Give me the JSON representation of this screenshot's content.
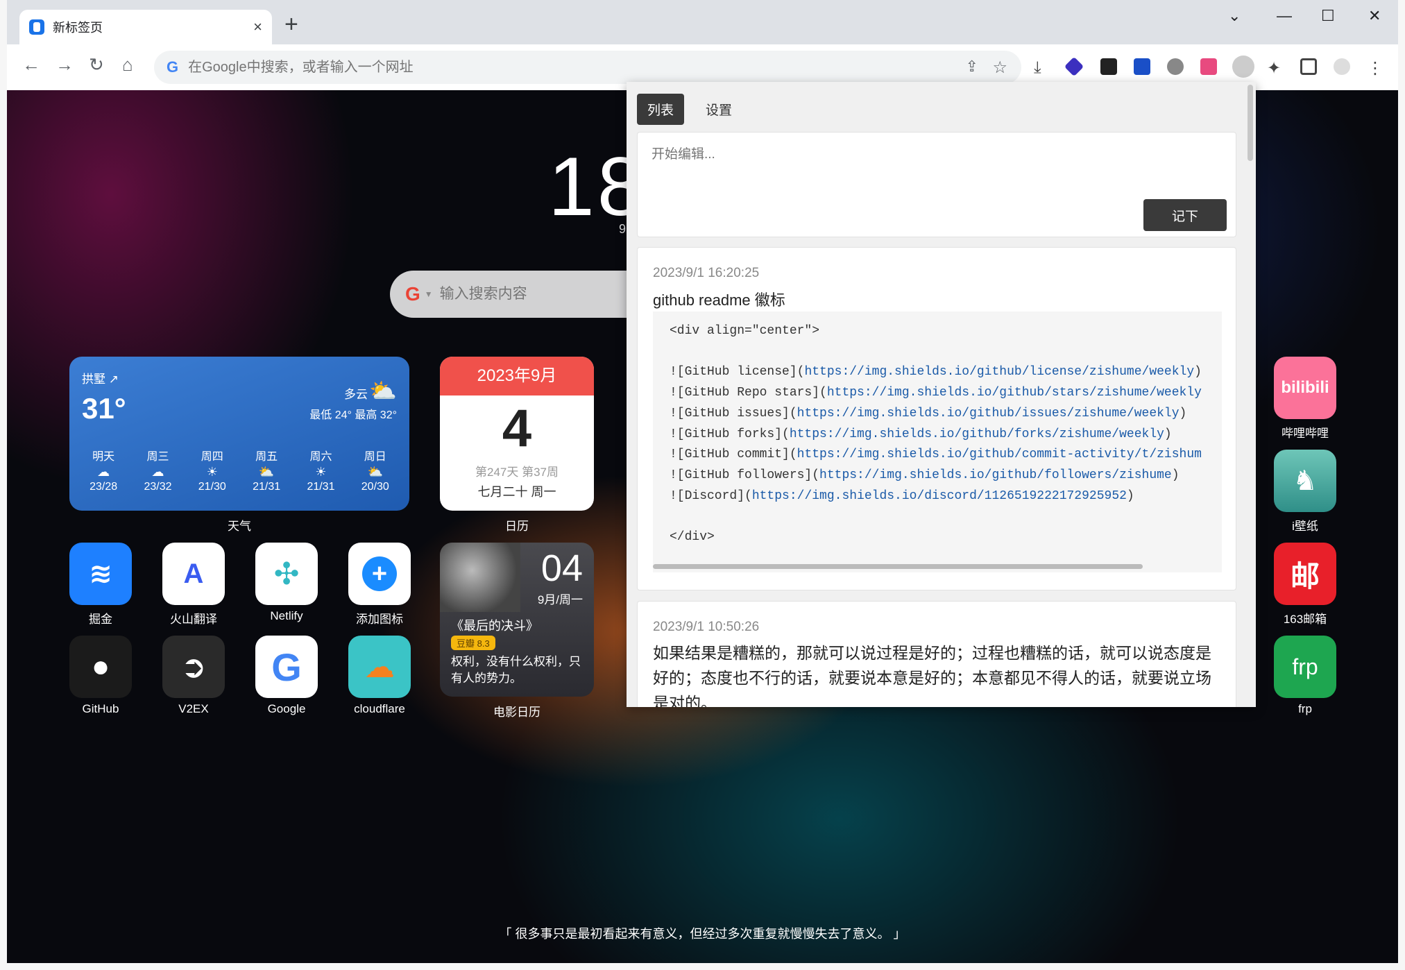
{
  "browser": {
    "tab_title": "新标签页",
    "tab_close": "×",
    "new_tab": "+",
    "omnibox_placeholder": "在Google中搜索，或者输入一个网址",
    "omnibox_g": "G"
  },
  "page": {
    "clock": "18",
    "clock_sub": "9",
    "search_placeholder": "输入搜索内容",
    "search_g": "G",
    "motto": "「 很多事只是最初看起来有意义，但经过多次重复就慢慢失去了意义。 」"
  },
  "weather": {
    "city": "拱墅 ↗",
    "temp": "31°",
    "cond": "多云",
    "range": "最低 24° 最高 32°",
    "label": "天气",
    "days": [
      {
        "name": "明天",
        "range": "23/28"
      },
      {
        "name": "周三",
        "range": "23/32"
      },
      {
        "name": "周四",
        "range": "21/30"
      },
      {
        "name": "周五",
        "range": "21/31"
      },
      {
        "name": "周六",
        "range": "21/31"
      },
      {
        "name": "周日",
        "range": "20/30"
      }
    ]
  },
  "calendar": {
    "month": "2023年9月",
    "day": "4",
    "week": "第247天 第37周",
    "lunar": "七月二十 周一",
    "label": "日历"
  },
  "movie": {
    "num": "04",
    "date": "9月/周一",
    "title": "《最后的决斗》",
    "rating": "豆瓣 8.3",
    "quote": "权利，没有什么权利，只有人的势力。",
    "label": "电影日历"
  },
  "apps": {
    "juejin": "掘金",
    "huoshan": "火山翻译",
    "netlify": "Netlify",
    "add": "添加图标",
    "github": "GitHub",
    "v2ex": "V2EX",
    "google": "Google",
    "cloudflare": "cloudflare",
    "bilibili": "哔哩哔哩",
    "bilibili_logo": "bilibili",
    "wallpaper": "i壁纸",
    "mail163": "163邮箱",
    "mail163_logo": "邮",
    "frp": "frp",
    "frp_logo": "frp"
  },
  "popup": {
    "tab_list": "列表",
    "tab_settings": "设置",
    "editor_placeholder": "开始编辑...",
    "save_button": "记下",
    "note1": {
      "time": "2023/9/1 16:20:25",
      "title": "github readme 徽标",
      "lines": [
        "<div align=\"center\">",
        "",
        "![GitHub license](https://img.shields.io/github/license/zishume/weekly)",
        "![GitHub Repo stars](https://img.shields.io/github/stars/zishume/weekly",
        "![GitHub issues](https://img.shields.io/github/issues/zishume/weekly)",
        "![GitHub forks](https://img.shields.io/github/forks/zishume/weekly)",
        "![GitHub commit](https://img.shields.io/github/commit-activity/t/zishum",
        "![GitHub followers](https://img.shields.io/github/followers/zishume)",
        "![Discord](https://img.shields.io/discord/1126519222172925952)",
        "",
        "</div>"
      ]
    },
    "note2": {
      "time": "2023/9/1 10:50:26",
      "body": "如果结果是糟糕的，那就可以说过程是好的；过程也糟糕的话，就可以说态度是好的；态度也不行的话，就要说本意是好的；本意都见不得人的话，就要说立场是对的。"
    }
  },
  "colors": {
    "accent_red": "#f0514b",
    "popup_dark": "#3a3a3a",
    "link_blue": "#1a5aa8"
  }
}
